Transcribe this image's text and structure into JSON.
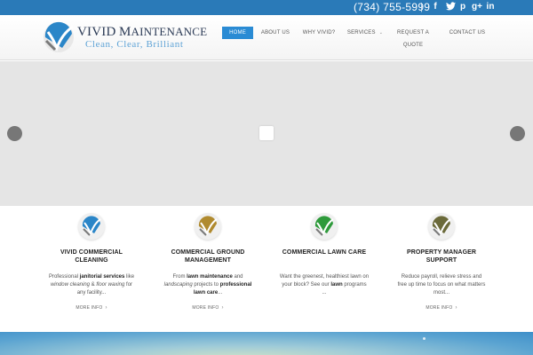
{
  "topbar": {
    "phone": "(734) 755-5999",
    "separator": "|",
    "social": [
      {
        "name": "facebook-icon",
        "glyph": "f"
      },
      {
        "name": "twitter-icon",
        "glyph": "t"
      },
      {
        "name": "pinterest-icon",
        "glyph": "p"
      },
      {
        "name": "googleplus-icon",
        "glyph": "g+"
      },
      {
        "name": "linkedin-icon",
        "glyph": "in"
      }
    ]
  },
  "header": {
    "brand_first": "VIVID",
    "brand_second_initial": "M",
    "brand_second_rest": "AINTENANCE",
    "tagline": "Clean, Clear, Brilliant"
  },
  "nav": {
    "items": [
      {
        "label": "HOME",
        "active": true
      },
      {
        "label": "ABOUT US"
      },
      {
        "label": "WHY VIVID?"
      },
      {
        "label": "SERVICES",
        "caret": "⌄"
      },
      {
        "label": "REQUEST A QUOTE"
      },
      {
        "label": "CONTACT US"
      }
    ]
  },
  "colors": {
    "brand_blue": "#2a7ab8",
    "nav_active": "#2a8bd4",
    "icon_blue": "#2b86c8",
    "icon_gold": "#b08a2e",
    "icon_green": "#2e9a3b",
    "icon_olive": "#6b6a3a"
  },
  "features": [
    {
      "title_line1": "VIVID COMMERCIAL",
      "title_line2": "CLEANING",
      "desc_parts": [
        "Professional ",
        "janitorial services",
        " like ",
        "window cleaning",
        " & ",
        "floor waxing",
        " for any facility..."
      ],
      "more": "MORE INFO",
      "icon_color": "#2b86c8"
    },
    {
      "title_line1": "COMMERCIAL GROUND",
      "title_line2": "MANAGEMENT",
      "desc_parts": [
        "From ",
        "lawn maintenance",
        " and ",
        "landscaping",
        " projects to ",
        "professional lawn care",
        "..."
      ],
      "more": "MORE INFO",
      "icon_color": "#b08a2e"
    },
    {
      "title_line1": "COMMERCIAL LAWN CARE",
      "title_line2": "",
      "desc_parts": [
        "Want the greenest, healthiest lawn on your block? See our ",
        "lawn",
        " programs ..."
      ],
      "more": "",
      "icon_color": "#2e9a3b"
    },
    {
      "title_line1": "PROPERTY MANAGER",
      "title_line2": "SUPPORT",
      "desc_parts": [
        "Reduce payroll, relieve stress and free up time to focus on what matters most..."
      ],
      "more": "MORE INFO",
      "icon_color": "#6b6a3a"
    }
  ]
}
